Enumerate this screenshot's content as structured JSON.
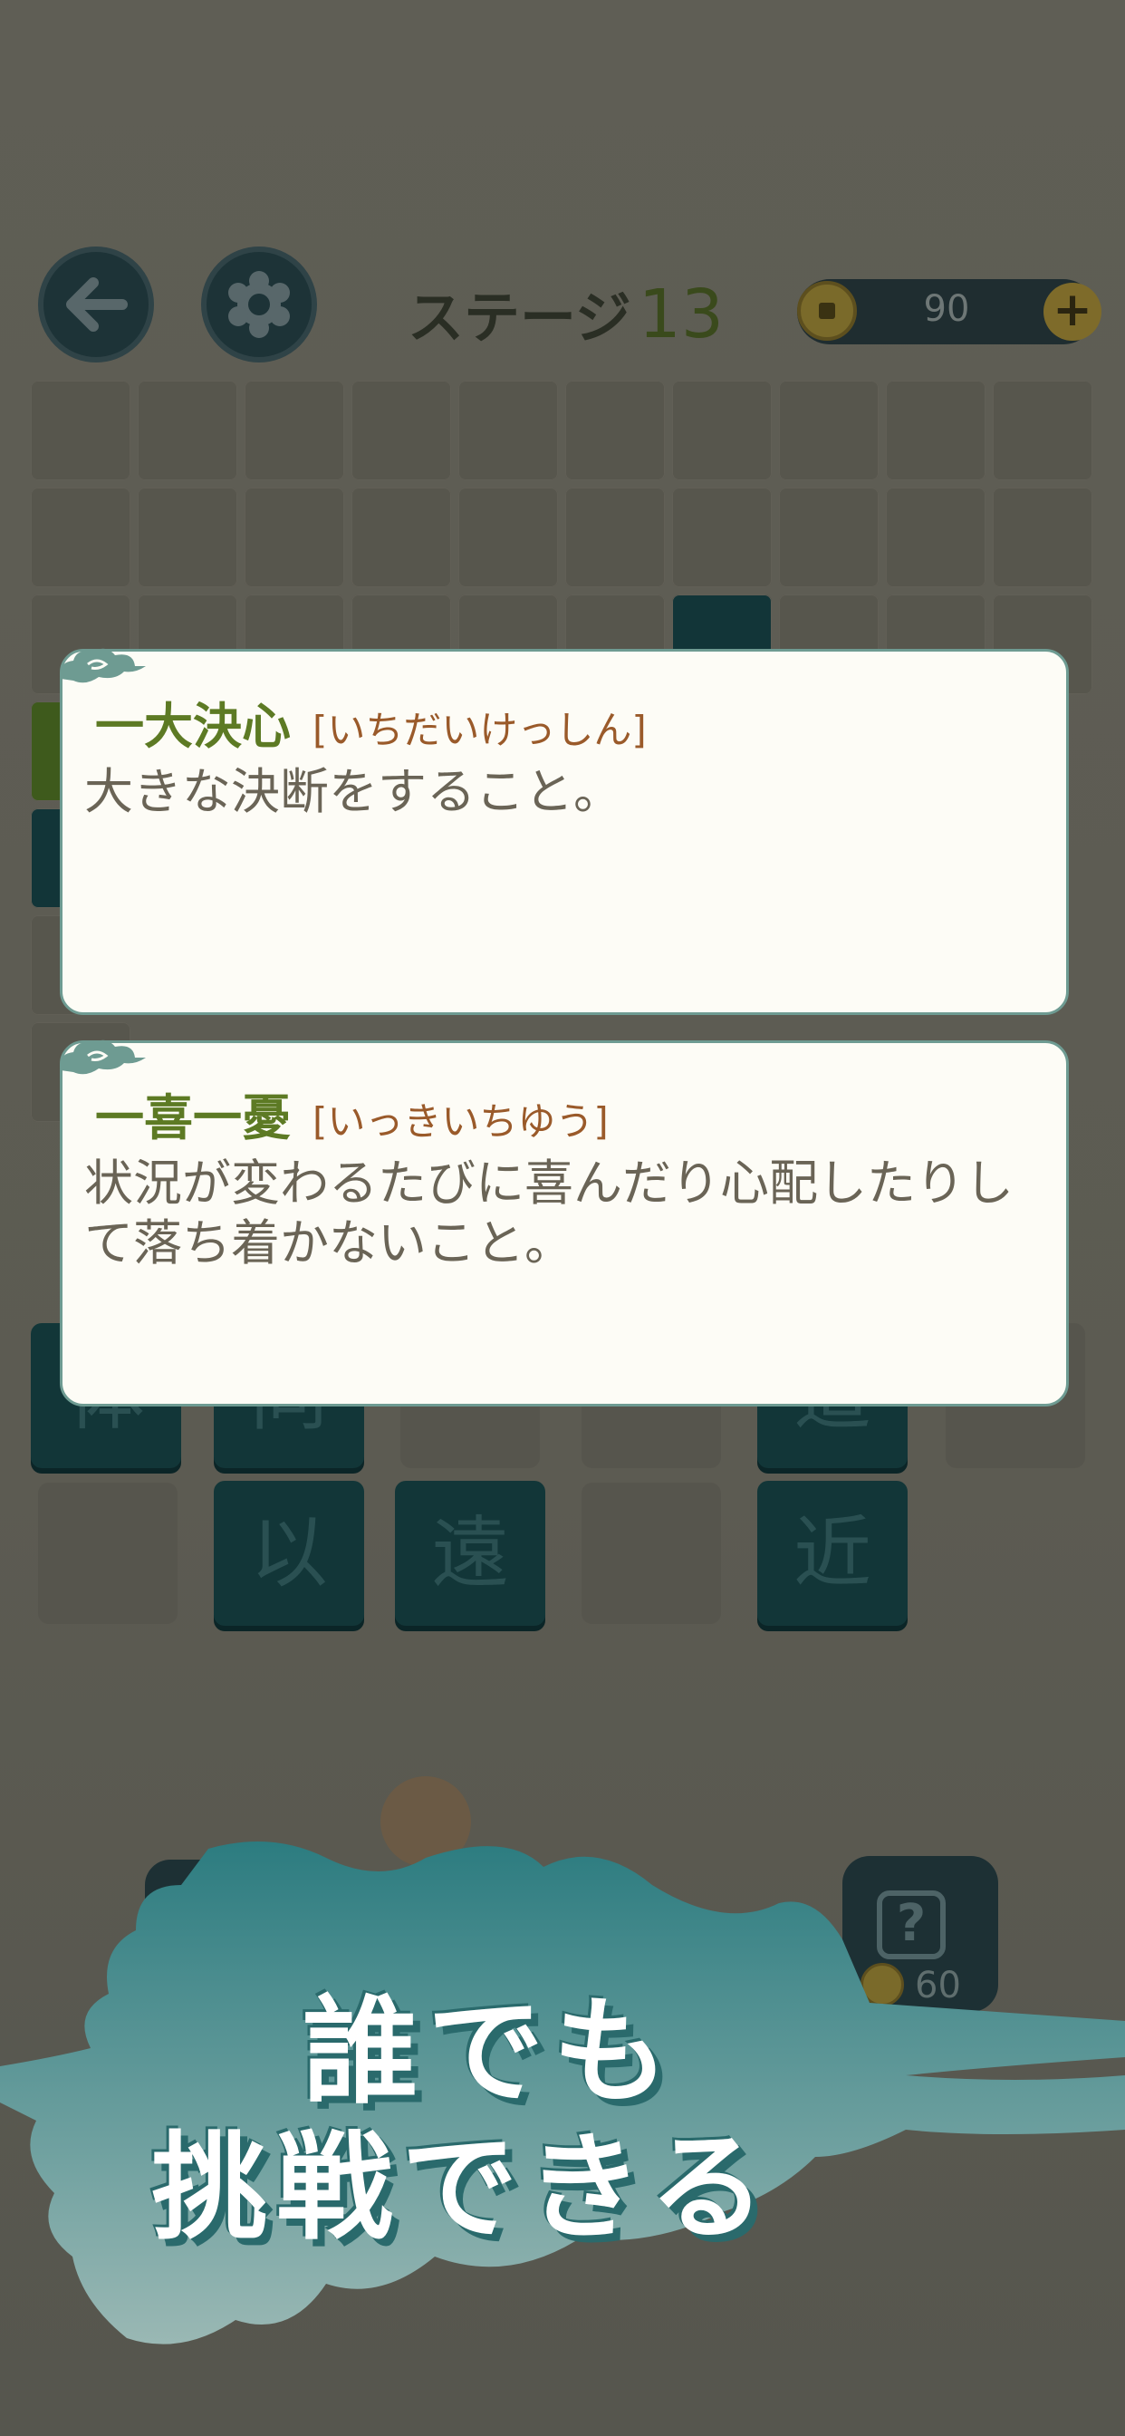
{
  "header": {
    "stage_label": "ステージ",
    "stage_number": "13",
    "coins": "90"
  },
  "board": {
    "tiles_row1": [
      "体",
      "同",
      "",
      "",
      "道",
      ""
    ],
    "tiles_row2": [
      "",
      "以",
      "遠",
      "",
      "近",
      ""
    ]
  },
  "cards": [
    {
      "idiom": "一大決心",
      "reading": "[いちだいけっしん]",
      "meaning": "大きな決断をすること。"
    },
    {
      "idiom": "一喜一憂",
      "reading": "[いっきいちゆう]",
      "meaning": "状況が変わるたびに喜んだり心配したりして落ち着かないこと。"
    }
  ],
  "hint": {
    "cost": "60"
  },
  "promo": {
    "line1": "誰でも",
    "line2": "挑戦できる"
  },
  "colors": {
    "accent_green": "#5d7a24",
    "reading_brown": "#9a5a2a",
    "tile_dark": "#123638",
    "banner_teal": "#2f7f82"
  },
  "icons": [
    "back-arrow-icon",
    "gear-icon",
    "coin-icon",
    "plus-icon",
    "hint-question-icon",
    "cloud-ornament-icon"
  ]
}
